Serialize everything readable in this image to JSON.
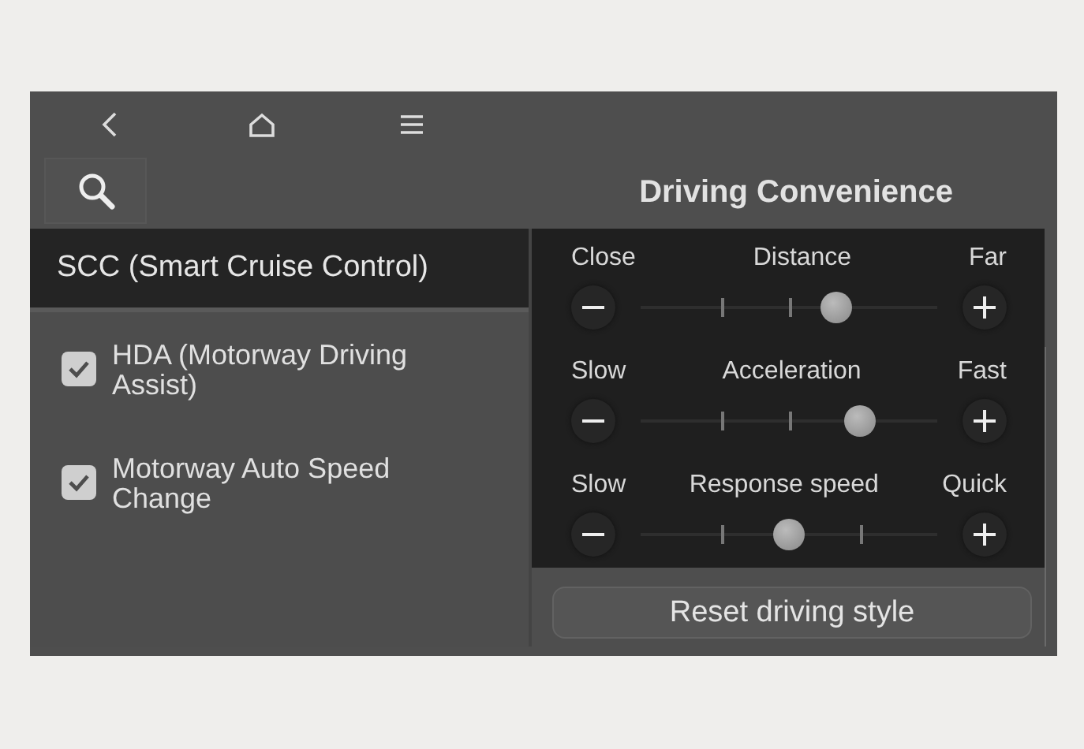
{
  "title": "Driving Convenience",
  "sidebar": {
    "items": [
      {
        "kind": "category",
        "label": "SCC (Smart Cruise Control)",
        "selected": true
      },
      {
        "kind": "checkbox",
        "label": "HDA (Motorway Driving Assist)",
        "checked": true,
        "selected": false
      },
      {
        "kind": "checkbox",
        "label": "Motorway Auto Speed Change",
        "checked": true,
        "selected": false
      }
    ]
  },
  "sliders": [
    {
      "name": "Distance",
      "min_label": "Close",
      "max_label": "Far",
      "level": 0.66
    },
    {
      "name": "Acceleration",
      "min_label": "Slow",
      "max_label": "Fast",
      "level": 0.74
    },
    {
      "name": "Response speed",
      "min_label": "Slow",
      "max_label": "Quick",
      "level": 0.5
    }
  ],
  "reset_button": "Reset driving style"
}
